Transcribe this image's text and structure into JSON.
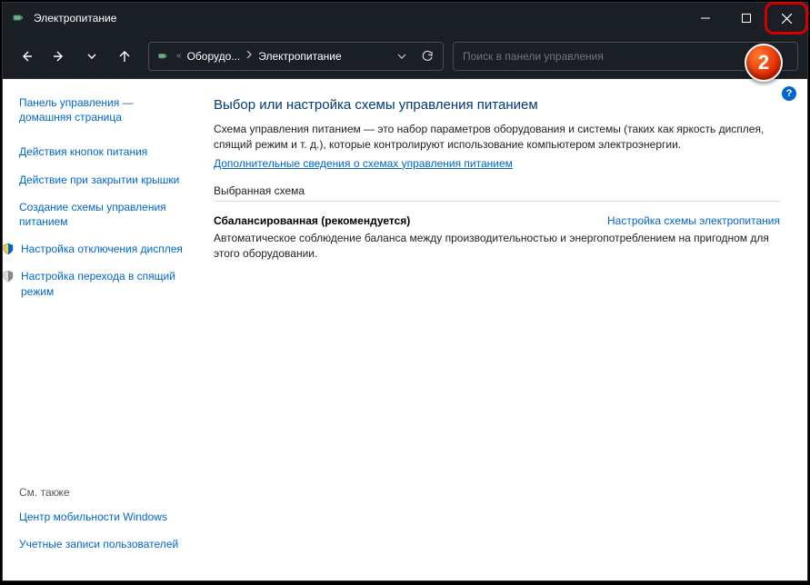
{
  "window": {
    "title": "Электропитание"
  },
  "breadcrumb": {
    "item1": "Оборудо...",
    "item2": "Электропитание"
  },
  "search": {
    "placeholder": "Поиск в панели управления"
  },
  "sidebar": {
    "home": "Панель управления — домашняя страница",
    "buttons": "Действия кнопок питания",
    "lid": "Действие при закрытии крышки",
    "create": "Создание схемы управления питанием",
    "display": "Настройка отключения дисплея",
    "sleep": "Настройка перехода в спящий режим",
    "seealso": "См. также",
    "mobility": "Центр мобильности Windows",
    "accounts": "Учетные записи пользователей"
  },
  "main": {
    "heading": "Выбор или настройка схемы управления питанием",
    "desc": "Схема управления питанием — это набор параметров оборудования и системы (таких как яркость дисплея, спящий режим и т. д.), которые контролируют использование компьютером электроэнергии.",
    "moreLink": "Дополнительные сведения о схемах управления питанием",
    "sectionLabel": "Выбранная схема",
    "planName": "Сбалансированная (рекомендуется)",
    "planSettings": "Настройка схемы электропитания",
    "planDesc": "Автоматическое соблюдение баланса между производительностью и энергопотреблением на пригодном для этого оборудовании."
  },
  "badge": "2"
}
